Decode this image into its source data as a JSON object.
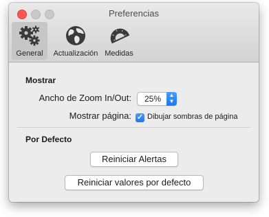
{
  "window": {
    "title": "Preferencias"
  },
  "tabs": [
    {
      "label": "General",
      "icon": "gears-icon",
      "selected": true
    },
    {
      "label": "Actualización",
      "icon": "globe-icon",
      "selected": false
    },
    {
      "label": "Medidas",
      "icon": "protractor-icon",
      "selected": false
    }
  ],
  "mostrar": {
    "section_title": "Mostrar",
    "zoom_label": "Ancho de Zoom In/Out:",
    "zoom_value": "25%",
    "page_label": "Mostrar página:",
    "shadows_checkbox_label": "Dibujar sombras de página",
    "shadows_checked": true
  },
  "defecto": {
    "section_title": "Por Defecto",
    "reset_alerts_button": "Reiniciar Alertas",
    "reset_defaults_button": "Reiniciar valores por defecto"
  },
  "colors": {
    "accent": "#1878f5",
    "close": "#fc5753"
  }
}
